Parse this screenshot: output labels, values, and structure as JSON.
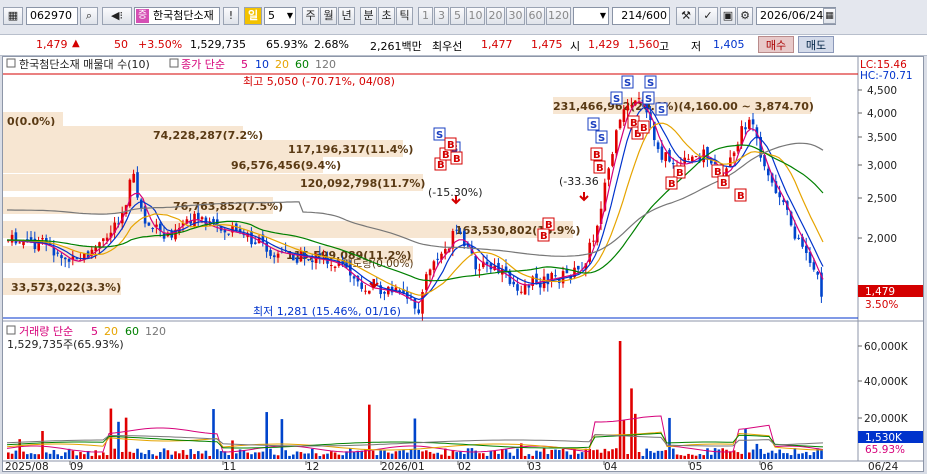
{
  "toolbar": {
    "code": "062970",
    "stock_name": "한국첨단소재",
    "excl": "!",
    "period_unit": "일",
    "period_value": "5",
    "period_buttons": [
      "주",
      "월",
      "년",
      "분",
      "초",
      "틱"
    ],
    "minute_buttons": [
      "1",
      "3",
      "5",
      "10",
      "20",
      "30",
      "60",
      "120"
    ],
    "count": "214",
    "count_total": "/600",
    "date": "2026/06/24"
  },
  "price_bar": {
    "price": "1,479",
    "arrow": "▲",
    "change": "50",
    "change_pct": "+3.50%",
    "volume": "1,529,735",
    "vol_ratio": "65.93%",
    "turnover": "2.68%",
    "amount": "2,261백만",
    "best_ask_label": "최우선",
    "best_ask": "1,477",
    "best_bid": "1,475",
    "open_label": "시",
    "open": "1,429",
    "high_label": "고",
    "high": "1,560",
    "low_label": "저",
    "low": "1,405",
    "buy_label": "매수",
    "sell_label": "매도"
  },
  "price_panel": {
    "title": "한국첨단소재 매물대 수(10)",
    "ma_label": "종가 단순",
    "ma_periods": [
      "5",
      "10",
      "20",
      "60",
      "120"
    ],
    "ma_colors": [
      "#d6007a",
      "#0033cc",
      "#e6a400",
      "#008000",
      "#777777"
    ],
    "lc": "LC:15.46",
    "hc": "HC:-70.71",
    "y_ticks": [
      "4,500",
      "4,000",
      "3,500",
      "3,000",
      "2,500",
      "2,000"
    ],
    "last_price": "1,479",
    "last_pct": "3.50%",
    "high_note": "최고 5,050 (-70.71%, 04/08)",
    "low_note": "최저 1,281 (15.46%, 01/16)",
    "annotation_1": "(-15.30%)",
    "annotation_2": "(-33.36",
    "signal_s": "S",
    "signal_b": "B",
    "volume_profile": [
      {
        "label": "231,466,962(20.6%)(4,160.00 ~ 3,874.70)",
        "value_pct": 20.6
      },
      {
        "label": "0(0.0%)",
        "value_pct": 0.0
      },
      {
        "label": "74,228,287(7.2%)",
        "value_pct": 7.2
      },
      {
        "label": "117,196,317(11.4%)",
        "value_pct": 11.4
      },
      {
        "label": "96,576,456(9.4%)",
        "value_pct": 9.4
      },
      {
        "label": "120,092,798(11.7%)",
        "value_pct": 11.7
      },
      {
        "label": "76,763,852(7.5%)",
        "value_pct": 7.5
      },
      {
        "label": "163,530,802(15.9%)",
        "value_pct": 15.9
      },
      {
        "label": "115,599,089(11.2%)",
        "value_pct": 11.2
      },
      {
        "label": "33,573,022(3.3%)",
        "value_pct": 3.3
      }
    ],
    "overlap_label": "매도량(0.00%)"
  },
  "volume_panel": {
    "title": "거래량 단순",
    "ma_periods": [
      "5",
      "20",
      "60",
      "120"
    ],
    "ma_colors": [
      "#d6007a",
      "#e6a400",
      "#008000",
      "#777777"
    ],
    "value_text": "1,529,735주(65.93%)",
    "y_ticks": [
      "60,000K",
      "40,000K",
      "20,000K"
    ],
    "last_vol": "1,530K",
    "last_pct": "65.93%"
  },
  "x_axis": {
    "labels": [
      "2025/08",
      "09",
      "11",
      "12",
      "2026/01",
      "02",
      "03",
      "04",
      "05",
      "06",
      "06/24"
    ]
  }
}
